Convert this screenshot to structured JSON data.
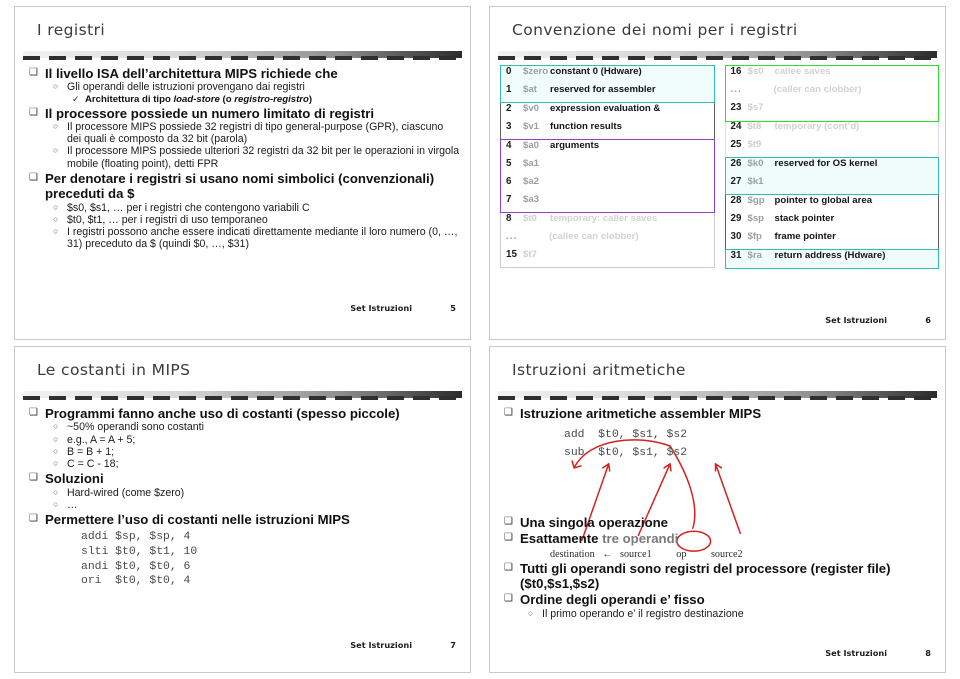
{
  "footer_label": "Set Istruzioni",
  "slides": [
    {
      "id": "slide-registri",
      "title": "I registri",
      "page": "5",
      "bullets": [
        {
          "lvl": 0,
          "text": "Il livello ISA dell’architettura MIPS richiede che"
        },
        {
          "lvl": 1,
          "text": "Gli operandi delle istruzioni provengano dai registri"
        },
        {
          "lvl": 2,
          "html": "Architettura di tipo <span class=\"it\">load-store</span> (o <span class=\"it\">registro-registro</span>)"
        },
        {
          "lvl": 0,
          "text": "Il processore possiede un numero limitato di registri"
        },
        {
          "lvl": 1,
          "text": "Il processore MIPS possiede 32 registri di tipo general-purpose (GPR), ciascuno dei quali è composto da 32 bit (parola)"
        },
        {
          "lvl": 1,
          "text": "Il processore MIPS possiede ulteriori 32 registri da 32 bit per le operazioni in virgola mobile (floating point), detti FPR"
        },
        {
          "lvl": 0,
          "text": "Per denotare i registri si usano nomi simbolici (convenzionali) preceduti da $"
        },
        {
          "lvl": 1,
          "text": "$s0, $s1, … per i registri che contengono variabili C"
        },
        {
          "lvl": 1,
          "text": "$t0, $t1, … per i registri di uso temporaneo"
        },
        {
          "lvl": 1,
          "text": "I registri possono anche essere indicati direttamente mediante il loro numero (0, …, 31) preceduto da $ (quindi $0, …, $31)"
        }
      ]
    },
    {
      "id": "slide-convenzione-nomi",
      "title": "Convenzione dei nomi per i registri",
      "page": "6",
      "register_table": {
        "left_groups": [
          {
            "style": "teal",
            "rows": [
              {
                "num": "0",
                "name": "$zero",
                "desc": "constant 0 (Hdware)",
                "dim": false
              },
              {
                "num": "1",
                "name": "$at",
                "desc": "reserved for assembler",
                "dim": false
              }
            ]
          },
          {
            "style": "gray",
            "rows": [
              {
                "num": "2",
                "name": "$v0",
                "desc": "expression evaluation &",
                "dim": false,
                "dark_name": true
              },
              {
                "num": "3",
                "name": "$v1",
                "desc": "function results",
                "dim": false,
                "dark_name": true
              }
            ]
          },
          {
            "style": "purple",
            "rows": [
              {
                "num": "4",
                "name": "$a0",
                "desc": "arguments",
                "dim": false,
                "dark_name": true
              },
              {
                "num": "5",
                "name": "$a1",
                "desc": "",
                "dim": false,
                "dark_name": true
              },
              {
                "num": "6",
                "name": "$a2",
                "desc": "",
                "dim": false,
                "dark_name": true
              },
              {
                "num": "7",
                "name": "$a3",
                "desc": "",
                "dim": false,
                "dark_name": true
              }
            ]
          },
          {
            "style": "faint",
            "rows": [
              {
                "num": "8",
                "name": "$t0",
                "desc": "temporary: caller saves",
                "dim": true
              },
              {
                "num": "...",
                "name": "",
                "desc": "(callee can clobber)",
                "dim": true,
                "indent": true
              },
              {
                "num": "15",
                "name": "$t7",
                "desc": "",
                "dim": true
              }
            ]
          }
        ],
        "right_groups": [
          {
            "style": "green",
            "rows": [
              {
                "num": "16",
                "name": "$s0",
                "desc": "callee saves",
                "dim": true
              },
              {
                "num": "...",
                "name": "",
                "desc": "(caller can clobber)",
                "dim": true,
                "indent": true
              },
              {
                "num": "23",
                "name": "$s7",
                "desc": "",
                "dim": true
              }
            ]
          },
          {
            "style": "lav",
            "rows": [
              {
                "num": "24",
                "name": "$t8",
                "desc": "temporary (cont’d)",
                "dim": true
              },
              {
                "num": "25",
                "name": "$t9",
                "desc": "",
                "dim": true
              }
            ]
          },
          {
            "style": "teal2",
            "rows": [
              {
                "num": "26",
                "name": "$k0",
                "desc": "reserved for OS kernel",
                "dim": false
              },
              {
                "num": "27",
                "name": "$k1",
                "desc": "",
                "dim": false
              }
            ]
          },
          {
            "style": "gray",
            "rows": [
              {
                "num": "28",
                "name": "$gp",
                "desc": "pointer to global area",
                "dim": false,
                "dark_name": true
              },
              {
                "num": "29",
                "name": "$sp",
                "desc": "stack pointer",
                "dim": false,
                "dark_name": true
              },
              {
                "num": "30",
                "name": "$fp",
                "desc": "frame pointer",
                "dim": false,
                "dark_name": true
              }
            ]
          },
          {
            "style": "teal3",
            "rows": [
              {
                "num": "31",
                "name": "$ra",
                "desc": "return address (Hdware)",
                "dim": false
              }
            ]
          }
        ]
      }
    },
    {
      "id": "slide-costanti",
      "title": "Le costanti in MIPS",
      "page": "7",
      "bullets": [
        {
          "lvl": 0,
          "text": "Programmi fanno anche uso di costanti (spesso piccole)"
        },
        {
          "lvl": 1,
          "text": "~50% operandi sono costanti"
        },
        {
          "lvl": 1,
          "text": "e.g., A = A + 5;"
        },
        {
          "lvl": 1,
          "text": "B = B + 1;"
        },
        {
          "lvl": 1,
          "text": "C = C - 18;"
        },
        {
          "lvl": 0,
          "text": "Soluzioni"
        },
        {
          "lvl": 1,
          "text": "Hard-wired (come $zero)"
        },
        {
          "lvl": 1,
          "text": "…"
        },
        {
          "lvl": 0,
          "text": "Permettere l’uso di costanti nelle istruzioni MIPS"
        }
      ],
      "code": "addi $sp, $sp, 4\nslti $t0, $t1, 10\nandi $t0, $t0, 6\nori  $t0, $t0, 4"
    },
    {
      "id": "slide-aritmetiche",
      "title": "Istruzioni aritmetiche",
      "page": "8",
      "bullet_head": "Istruzione aritmetiche assembler MIPS",
      "code": "add  $t0, $s1, $s2\nsub  $t0, $s1, $s2",
      "bullets_tail": [
        {
          "lvl": 0,
          "html": "Una <b>singola operazione</b>"
        },
        {
          "lvl": 0,
          "html": "Esattamente <span style=\"color:#7a7a7a\">tre operandi</span>"
        }
      ],
      "operand_line": "destination ← source1     op     source2",
      "operand_parts": {
        "destination": "destination",
        "arrow": "←",
        "source1": "source1",
        "op": "op",
        "source2": "source2"
      },
      "bullets_tail2": [
        {
          "lvl": 0,
          "html": "<b>Tutti gli operandi sono</b> registri del processore (register file) (<span class=\"mono\">$t0,$s1,$s2</span>)"
        },
        {
          "lvl": 0,
          "html": "Ordine degli operandi e’ fisso"
        },
        {
          "lvl": 1,
          "html": "Il primo operando e’ il registro destinazione"
        }
      ],
      "annotation_color": "#d42020"
    }
  ]
}
